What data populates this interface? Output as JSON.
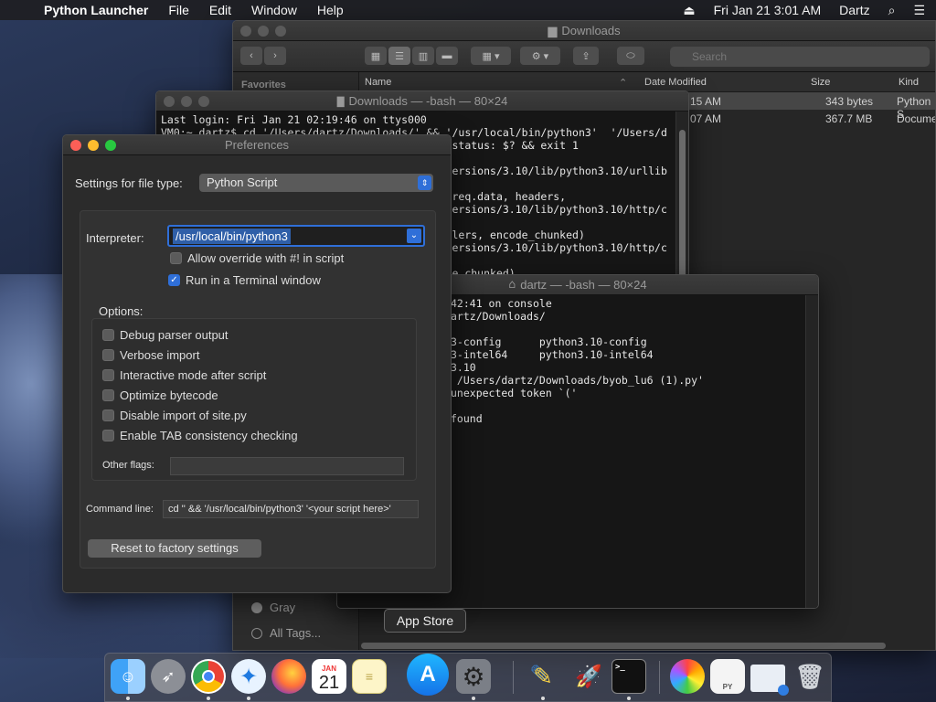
{
  "menubar": {
    "app_name": "Python Launcher",
    "items": [
      "File",
      "Edit",
      "Window",
      "Help"
    ],
    "datetime": "Fri Jan 21  3:01 AM",
    "user": "Dartz"
  },
  "finder": {
    "title": "Downloads",
    "search_placeholder": "Search",
    "sidebar_header": "Favorites",
    "columns": {
      "name": "Name",
      "date": "Date Modified",
      "size": "Size",
      "kind": "Kind"
    },
    "rows": [
      {
        "date": "2:15 AM",
        "size": "343 bytes",
        "kind": "Python S"
      },
      {
        "date": "2:07 AM",
        "size": "367.7 MB",
        "kind": "Docume"
      }
    ],
    "tags": {
      "gray": "Gray",
      "all": "All Tags..."
    }
  },
  "terminal1": {
    "title": "Downloads — -bash — 80×24",
    "lines": [
      "Last login: Fri Jan 21 02:19:46 on ttys000",
      "VM0:~ dartz$ cd '/Users/dartz/Downloads/' && '/usr/local/bin/python3'  '/Users/d",
      "                                              status: $? && exit 1",
      "",
      "                                             /ersions/3.10/lib/python3.10/urllib",
      "",
      "                                              req.data, headers,",
      "                                             /ersions/3.10/lib/python3.10/http/c",
      "",
      "                                              lers, encode_chunked)",
      "                                             /ersions/3.10/lib/python3.10/http/c",
      "",
      "                                              e_chunked)"
    ]
  },
  "terminal2": {
    "title": "dartz — -bash — 80×24",
    "lines": [
      "42:41 on console",
      "artz/Downloads/",
      "",
      "3-config      python3.10-config",
      "3-intel64     python3.10-intel64",
      "3.10",
      " /Users/dartz/Downloads/byob_lu6 (1).py'",
      "unexpected token `('",
      "",
      "found"
    ]
  },
  "preferences": {
    "title": "Preferences",
    "file_type_label": "Settings for file type:",
    "file_type_value": "Python Script",
    "interpreter_label": "Interpreter:",
    "interpreter_value": "/usr/local/bin/python3",
    "allow_override": "Allow override with #! in script",
    "run_terminal": "Run in a Terminal window",
    "options_label": "Options:",
    "options": [
      "Debug parser output",
      "Verbose import",
      "Interactive mode after script",
      "Optimize bytecode",
      "Disable import of site.py",
      "Enable TAB consistency checking"
    ],
    "other_flags_label": "Other flags:",
    "other_flags_value": "",
    "command_line_label": "Command line:",
    "command_line_value": "cd '' && '/usr/local/bin/python3'  '<your script here>'",
    "reset_button": "Reset to factory settings"
  },
  "dock": {
    "tooltip": "App Store",
    "calendar_month": "JAN",
    "calendar_day": "21",
    "terminal_glyph": ">_"
  }
}
